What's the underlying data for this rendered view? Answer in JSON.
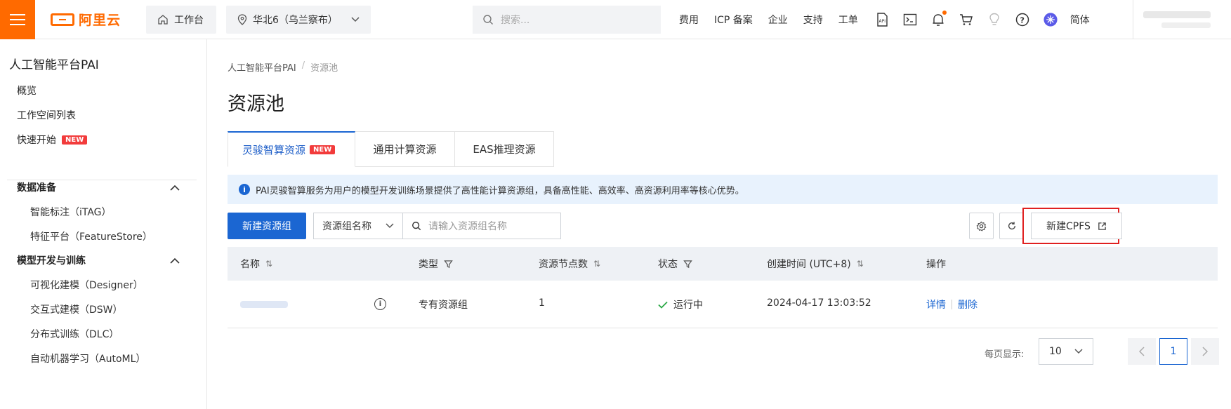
{
  "topbar": {
    "logo_text": "阿里云",
    "workbench": "工作台",
    "region": "华北6（乌兰察布）",
    "search_placeholder": "搜索...",
    "links": [
      "费用",
      "ICP 备案",
      "企业",
      "支持",
      "工单"
    ],
    "lang": "简体",
    "icons": [
      "api-icon",
      "terminal-icon",
      "bell-icon",
      "cart-icon",
      "bulb-icon",
      "help-icon",
      "avatar-icon"
    ]
  },
  "sidebar": {
    "title": "人工智能平台PAI",
    "top_items": [
      "概览",
      "工作空间列表",
      "快速开始"
    ],
    "new_badge": "NEW",
    "sections": [
      {
        "label": "数据准备",
        "items": [
          "智能标注（iTAG）",
          "特征平台（FeatureStore）"
        ]
      },
      {
        "label": "模型开发与训练",
        "items": [
          "可视化建模（Designer）",
          "交互式建模（DSW）",
          "分布式训练（DLC）",
          "自动机器学习（AutoML）"
        ]
      }
    ]
  },
  "main": {
    "breadcrumb": [
      "人工智能平台PAI",
      "资源池"
    ],
    "title": "资源池",
    "tabs": [
      "灵骏智算资源",
      "通用计算资源",
      "EAS推理资源"
    ],
    "tab_badge": "NEW",
    "notice": "PAI灵骏智算服务为用户的模型开发训练场景提供了高性能计算资源组，具备高性能、高效率、高资源利用率等核心优势。",
    "new_group_btn": "新建资源组",
    "filter_select": "资源组名称",
    "search_placeholder": "请输入资源组名称",
    "new_cpfs_btn": "新建CPFS",
    "columns": [
      "名称",
      "类型",
      "资源节点数",
      "状态",
      "创建时间 (UTC+8)",
      "操作"
    ],
    "rows": [
      {
        "type": "专有资源组",
        "nodes": "1",
        "status": "运行中",
        "created": "2024-04-17 13:03:52",
        "op_detail": "详情",
        "op_delete": "删除"
      }
    ],
    "pager": {
      "label": "每页显示:",
      "page_size": "10",
      "current_page": "1"
    }
  }
}
